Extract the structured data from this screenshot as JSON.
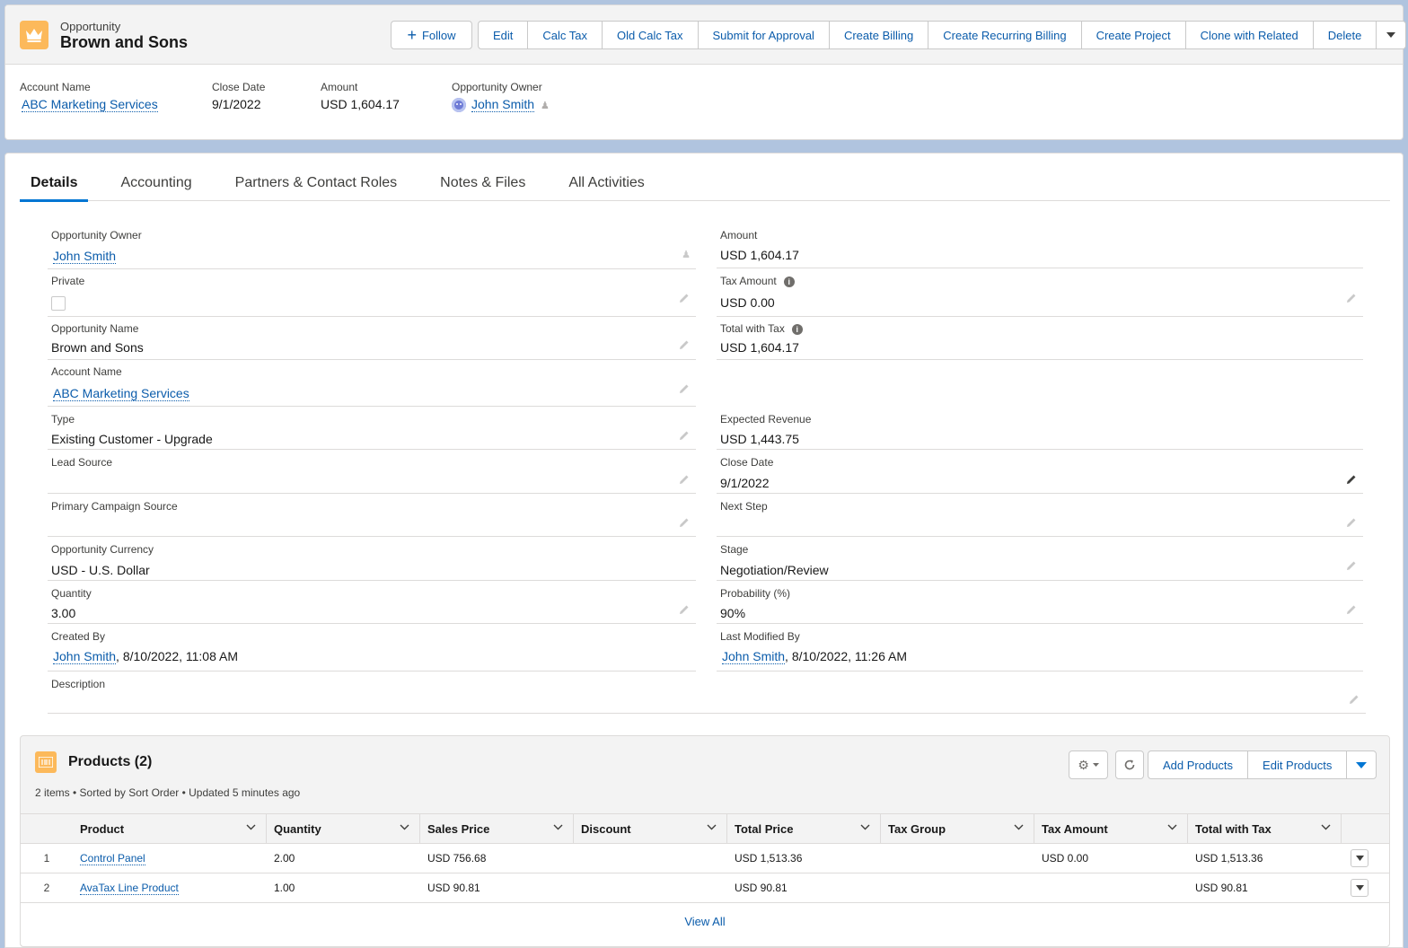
{
  "header": {
    "object_type": "Opportunity",
    "title": "Brown and Sons",
    "follow_label": "Follow",
    "actions": [
      "Edit",
      "Calc Tax",
      "Old Calc Tax",
      "Submit for Approval",
      "Create Billing",
      "Create Recurring Billing",
      "Create Project",
      "Clone with Related",
      "Delete"
    ],
    "highlights": {
      "account_name_label": "Account Name",
      "account_name": "ABC Marketing Services",
      "close_date_label": "Close Date",
      "close_date": "9/1/2022",
      "amount_label": "Amount",
      "amount": "USD 1,604.17",
      "owner_label": "Opportunity Owner",
      "owner": "John Smith"
    }
  },
  "tabs": [
    "Details",
    "Accounting",
    "Partners & Contact Roles",
    "Notes & Files",
    "All Activities"
  ],
  "details": {
    "left": [
      {
        "label": "Opportunity Owner",
        "value": "John Smith"
      },
      {
        "label": "Private",
        "value": ""
      },
      {
        "label": "Opportunity Name",
        "value": "Brown and Sons"
      },
      {
        "label": "Account Name",
        "value": "ABC Marketing Services"
      },
      {
        "label": "Type",
        "value": "Existing Customer - Upgrade"
      },
      {
        "label": "Lead Source",
        "value": ""
      },
      {
        "label": "Primary Campaign Source",
        "value": ""
      },
      {
        "label": "Opportunity Currency",
        "value": "USD - U.S. Dollar"
      },
      {
        "label": "Quantity",
        "value": "3.00"
      },
      {
        "label": "Created By",
        "value": "John Smith",
        "suffix": ", 8/10/2022, 11:08 AM"
      },
      {
        "label": "Description",
        "value": ""
      }
    ],
    "right": [
      {
        "label": "Amount",
        "value": "USD 1,604.17"
      },
      {
        "label": "Tax Amount",
        "value": "USD 0.00"
      },
      {
        "label": "Total with Tax",
        "value": "USD 1,604.17"
      },
      {
        "label": "Expected Revenue",
        "value": "USD 1,443.75"
      },
      {
        "label": "Close Date",
        "value": "9/1/2022"
      },
      {
        "label": "Next Step",
        "value": ""
      },
      {
        "label": "Stage",
        "value": "Negotiation/Review"
      },
      {
        "label": "Probability (%)",
        "value": "90%"
      },
      {
        "label": "Last Modified By",
        "value": "John Smith",
        "suffix": ", 8/10/2022, 11:26 AM"
      }
    ]
  },
  "products": {
    "title": "Products (2)",
    "subtitle": "2 items • Sorted by Sort Order • Updated 5 minutes ago",
    "add_label": "Add Products",
    "edit_label": "Edit Products",
    "columns": [
      "Product",
      "Quantity",
      "Sales Price",
      "Discount",
      "Total Price",
      "Tax Group",
      "Tax Amount",
      "Total with Tax"
    ],
    "rows": [
      {
        "num": "1",
        "product": "Control Panel",
        "quantity": "2.00",
        "sales_price": "USD 756.68",
        "discount": "",
        "total_price": "USD 1,513.36",
        "tax_group": "",
        "tax_amount": "USD 0.00",
        "total_with_tax": "USD 1,513.36"
      },
      {
        "num": "2",
        "product": "AvaTax Line Product",
        "quantity": "1.00",
        "sales_price": "USD 90.81",
        "discount": "",
        "total_price": "USD 90.81",
        "tax_group": "",
        "tax_amount": "",
        "total_with_tax": "USD 90.81"
      }
    ],
    "view_all": "View All"
  },
  "colors": {
    "brand_blue": "#0176d3",
    "link": "#0b5cab",
    "opportunity_icon": "#fcb95b"
  }
}
